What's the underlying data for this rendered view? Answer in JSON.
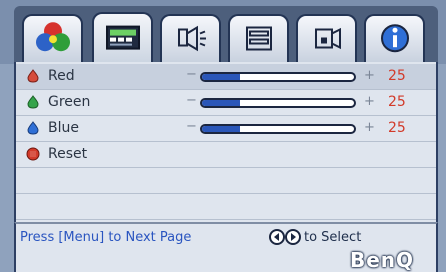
{
  "tabs": [
    {
      "icon": "color-circles-icon",
      "active": false
    },
    {
      "icon": "picture-settings-icon",
      "active": true
    },
    {
      "icon": "audio-setup-icon",
      "active": false
    },
    {
      "icon": "system-settings-icon",
      "active": false
    },
    {
      "icon": "advanced-settings-icon",
      "active": false
    },
    {
      "icon": "information-icon",
      "active": false
    }
  ],
  "rows": [
    {
      "label": "Red",
      "value": "25",
      "fill": 0.25,
      "bullet_color": "#d64c3b"
    },
    {
      "label": "Green",
      "value": "25",
      "fill": 0.25,
      "bullet_color": "#34a34a"
    },
    {
      "label": "Blue",
      "value": "25",
      "fill": 0.25,
      "bullet_color": "#2f6fd6"
    },
    {
      "label": "Reset",
      "bullet_color": "#d23a2a"
    }
  ],
  "footer": {
    "left_hint": "Press [Menu] to Next Page",
    "right_hint": "to Select",
    "brand": "BenQ"
  },
  "colors": {
    "background": "#8fa2bd",
    "panel": "#dfe5ee",
    "accent": "#2a56b8",
    "value_text": "#d23a2a"
  }
}
